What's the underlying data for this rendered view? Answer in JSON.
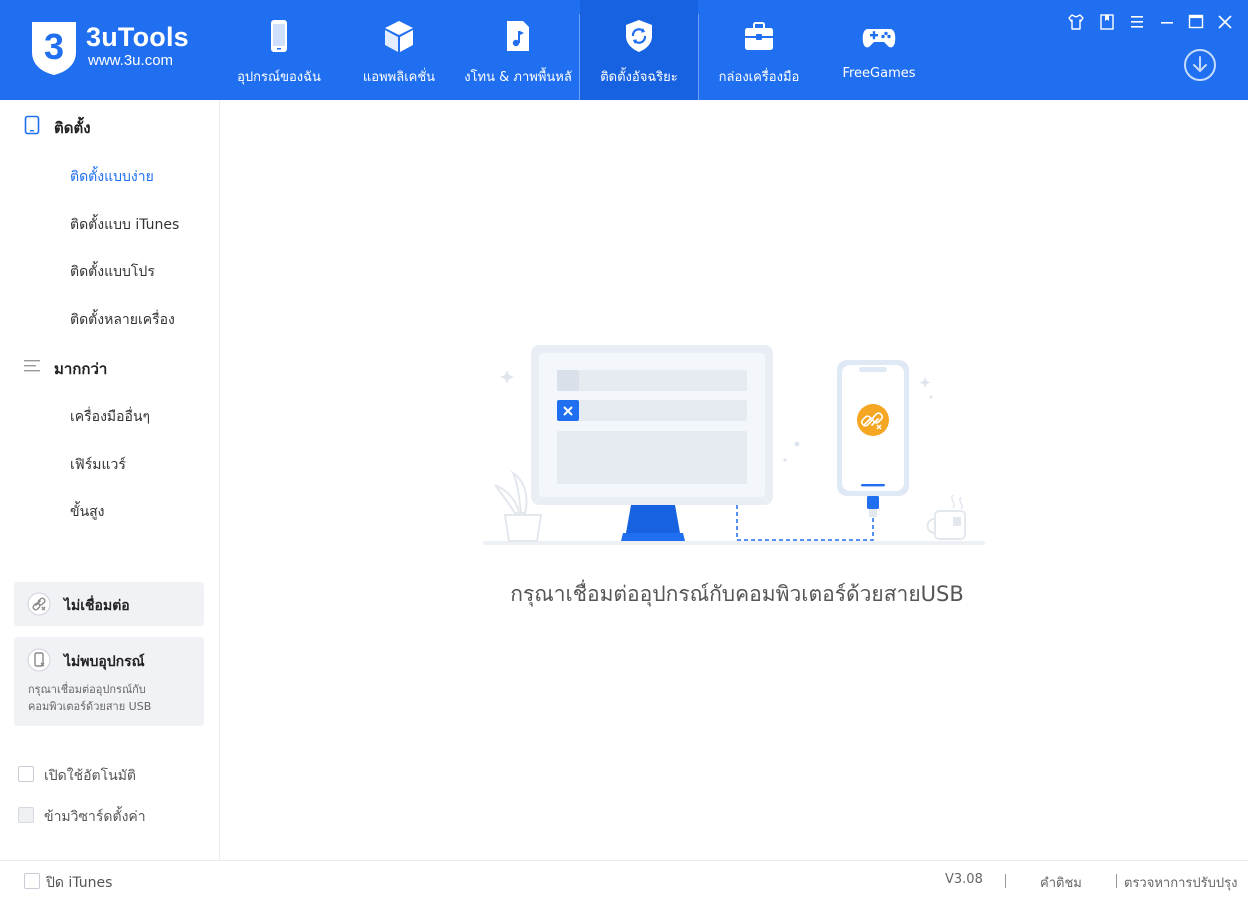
{
  "app": {
    "name": "3uTools",
    "url": "www.3u.com",
    "logo_digit": "3"
  },
  "nav": {
    "tabs": [
      {
        "label": "อุปกรณ์ของฉัน",
        "icon": "phone-icon"
      },
      {
        "label": "แอพพลิเคชั่น",
        "icon": "cube-icon"
      },
      {
        "label": "งโทน & ภาพพื้นหลั",
        "icon": "music-folder-icon"
      },
      {
        "label": "ติดตั้งอัจฉริยะ",
        "icon": "shield-sync-icon",
        "active": true
      },
      {
        "label": "กล่องเครื่องมือ",
        "icon": "toolbox-icon"
      },
      {
        "label": "FreeGames",
        "icon": "gamepad-icon"
      }
    ]
  },
  "sidebar": {
    "install_header": "ติดตั้ง",
    "install_items": [
      "ติดตั้งแบบง่าย",
      "ติดตั้งแบบ iTunes",
      "ติดตั้งแบบโปร",
      "ติดตั้งหลายเครื่อง"
    ],
    "more_header": "มากกว่า",
    "more_items": [
      "เครื่องมืออื่นๆ",
      "เฟิร์มแวร์",
      "ขั้นสูง"
    ],
    "status": {
      "disconnected_title": "ไม่เชื่อมต่อ",
      "no_device_title": "ไม่พบอุปกรณ์",
      "no_device_desc_line1": "กรุณาเชื่อมต่ออุปกรณ์กับ",
      "no_device_desc_line2": "คอมพิวเตอร์ด้วยสาย USB"
    },
    "options": {
      "auto_activate": "เปิดใช้อัตโนมัติ",
      "skip_setup": "ข้ามวิซาร์ดตั้งค่า"
    }
  },
  "main": {
    "prompt": "กรุณาเชื่อมต่ออุปกรณ์กับคอมพิวเตอร์ด้วยสายUSB"
  },
  "footer": {
    "close_itunes": "ปิด iTunes",
    "version": "V3.08",
    "feedback": "คำติชม",
    "check_update": "ตรวจหาการปรับปรุง"
  },
  "colors": {
    "accent": "#1f6ff0",
    "header_active": "#1762e0",
    "sidebar_active": "#1f6ff0",
    "warning": "#f5a623"
  }
}
